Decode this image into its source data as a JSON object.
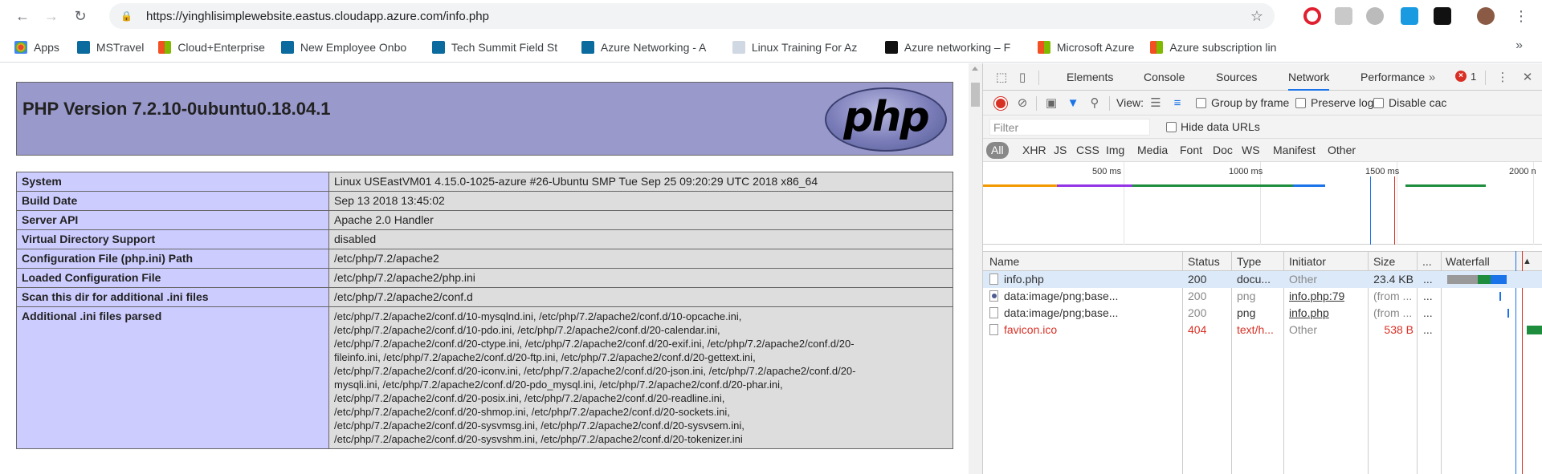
{
  "browser": {
    "url": "https://yinghlisimplewebsite.eastus.cloudapp.azure.com/info.php",
    "bookmarks": [
      "Apps",
      "MSTravel",
      "Cloud+Enterprise",
      "New Employee Onbo",
      "Tech Summit Field St",
      "Azure Networking - A",
      "Linux Training For Az",
      "Azure networking – F",
      "Microsoft Azure",
      "Azure subscription lin"
    ],
    "bookmarks_more": "»"
  },
  "php": {
    "version": "PHP Version 7.2.10-0ubuntu0.18.04.1",
    "logo_text": "php",
    "rows": [
      {
        "key": "System",
        "value": "Linux USEastVM01 4.15.0-1025-azure #26-Ubuntu SMP Tue Sep 25 09:20:29 UTC 2018 x86_64"
      },
      {
        "key": "Build Date",
        "value": "Sep 13 2018 13:45:02"
      },
      {
        "key": "Server API",
        "value": "Apache 2.0 Handler"
      },
      {
        "key": "Virtual Directory Support",
        "value": "disabled"
      },
      {
        "key": "Configuration File (php.ini) Path",
        "value": "/etc/php/7.2/apache2"
      },
      {
        "key": "Loaded Configuration File",
        "value": "/etc/php/7.2/apache2/php.ini"
      },
      {
        "key": "Scan this dir for additional .ini files",
        "value": "/etc/php/7.2/apache2/conf.d"
      },
      {
        "key": "Additional .ini files parsed",
        "value_lines": [
          "/etc/php/7.2/apache2/conf.d/10-mysqlnd.ini, /etc/php/7.2/apache2/conf.d/10-opcache.ini,",
          "/etc/php/7.2/apache2/conf.d/10-pdo.ini, /etc/php/7.2/apache2/conf.d/20-calendar.ini,",
          "/etc/php/7.2/apache2/conf.d/20-ctype.ini, /etc/php/7.2/apache2/conf.d/20-exif.ini, /etc/php/7.2/apache2/conf.d/20-",
          "fileinfo.ini, /etc/php/7.2/apache2/conf.d/20-ftp.ini, /etc/php/7.2/apache2/conf.d/20-gettext.ini,",
          "/etc/php/7.2/apache2/conf.d/20-iconv.ini, /etc/php/7.2/apache2/conf.d/20-json.ini, /etc/php/7.2/apache2/conf.d/20-",
          "mysqli.ini, /etc/php/7.2/apache2/conf.d/20-pdo_mysql.ini, /etc/php/7.2/apache2/conf.d/20-phar.ini,",
          "/etc/php/7.2/apache2/conf.d/20-posix.ini, /etc/php/7.2/apache2/conf.d/20-readline.ini,",
          "/etc/php/7.2/apache2/conf.d/20-shmop.ini, /etc/php/7.2/apache2/conf.d/20-sockets.ini,",
          "/etc/php/7.2/apache2/conf.d/20-sysvmsg.ini, /etc/php/7.2/apache2/conf.d/20-sysvsem.ini,",
          "/etc/php/7.2/apache2/conf.d/20-sysvshm.ini, /etc/php/7.2/apache2/conf.d/20-tokenizer.ini"
        ]
      }
    ]
  },
  "devtools": {
    "tabs": [
      "Elements",
      "Console",
      "Sources",
      "Network",
      "Performance"
    ],
    "active_tab": "Network",
    "error_count": "1",
    "toolbar": {
      "view_label": "View:",
      "group_by_frame": "Group by frame",
      "preserve_log": "Preserve log",
      "disable_cache": "Disable cac"
    },
    "filter_placeholder": "Filter",
    "hide_data_urls": "Hide data URLs",
    "types": [
      "All",
      "XHR",
      "JS",
      "CSS",
      "Img",
      "Media",
      "Font",
      "Doc",
      "WS",
      "Manifest",
      "Other"
    ],
    "overview_ticks": [
      "500 ms",
      "1000 ms",
      "1500 ms",
      "2000 n"
    ],
    "columns": [
      "Name",
      "Status",
      "Type",
      "Initiator",
      "Size",
      "...",
      "Waterfall"
    ],
    "requests": [
      {
        "name": "info.php",
        "status": "200",
        "type": "docu...",
        "initiator": "Other",
        "size": "23.4 KB",
        "more": "..."
      },
      {
        "name": "data:image/png;base...",
        "status": "200",
        "type": "png",
        "initiator": "info.php:79",
        "size": "(from ...",
        "more": "..."
      },
      {
        "name": "data:image/png;base...",
        "status": "200",
        "type": "png",
        "initiator": "info.php",
        "size": "(from ...",
        "more": "..."
      },
      {
        "name": "favicon.ico",
        "status": "404",
        "type": "text/h...",
        "initiator": "Other",
        "size": "538 B",
        "more": "..."
      }
    ]
  }
}
